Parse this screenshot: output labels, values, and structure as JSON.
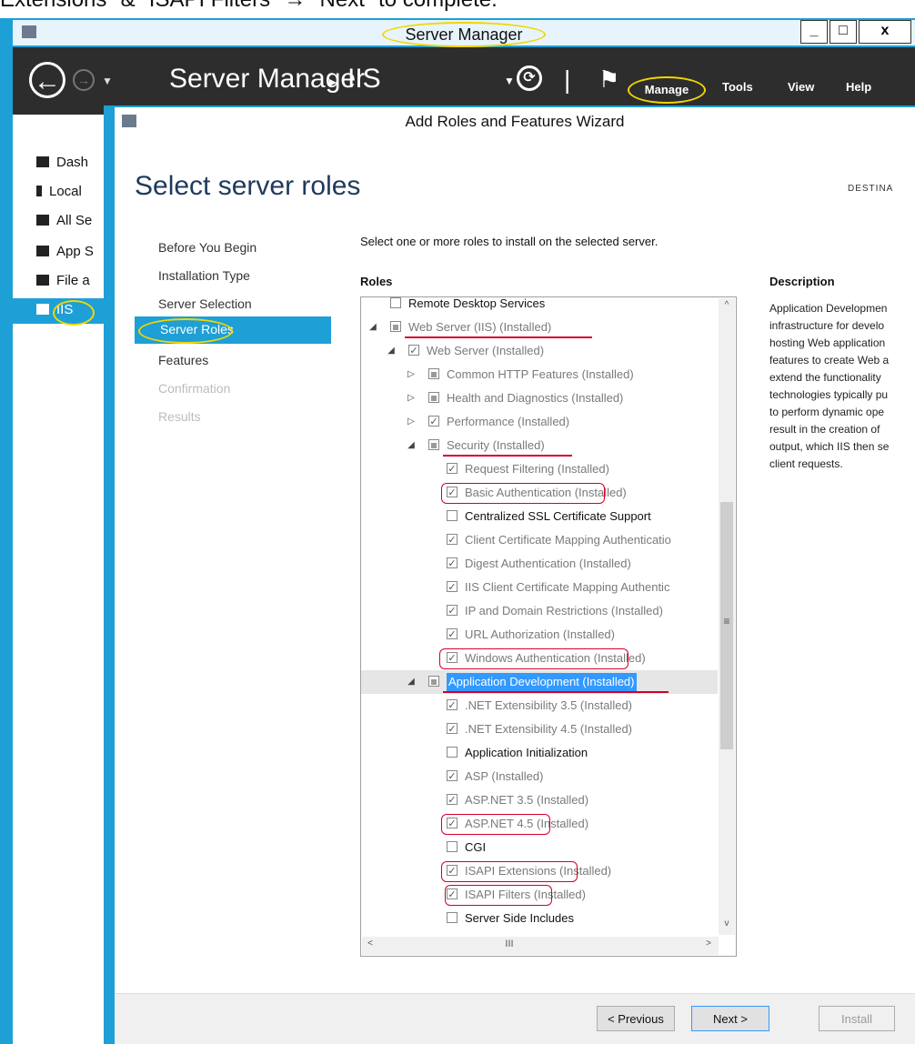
{
  "caption": "Extensions\" & \"ISAPI Filters\" → \"Next\" to complete.",
  "server_manager": {
    "window_title": "Server Manager",
    "window_buttons": [
      "_",
      "□",
      "x"
    ],
    "breadcrumb": [
      "Server Manager",
      "▸",
      "IIS"
    ],
    "menus": [
      "Manage",
      "Tools",
      "View",
      "Help"
    ],
    "sidebar": [
      "Dash",
      "Local",
      "All Se",
      "App S",
      "File a",
      "IIS"
    ]
  },
  "wizard": {
    "title": "Add Roles and Features Wizard",
    "page_title": "Select server roles",
    "destination_label": "DESTINA",
    "nav": [
      "Before You Begin",
      "Installation Type",
      "Server Selection",
      "Server Roles",
      "Features",
      "Confirmation",
      "Results"
    ],
    "instruction": "Select one or more roles to install on the selected server.",
    "roles_heading": "Roles",
    "description_heading": "Description",
    "description_text": "Application Developmen\ninfrastructure for develo\nhosting Web application\nfeatures to create Web a\nextend the functionality\ntechnologies typically pu\nto perform dynamic ope\nresult in the creation of\noutput, which IIS then se\nclient requests.",
    "roles": [
      {
        "label": "Remote Desktop Services",
        "level": 0,
        "expander": "",
        "check": "none",
        "muted": false
      },
      {
        "label": "Web Server (IIS) (Installed)",
        "level": 0,
        "expander": "◢",
        "check": "partial",
        "muted": true
      },
      {
        "label": "Web Server (Installed)",
        "level": 1,
        "expander": "◢",
        "check": "checked",
        "muted": true
      },
      {
        "label": "Common HTTP Features (Installed)",
        "level": 2,
        "expander": "▷",
        "check": "partial",
        "muted": true
      },
      {
        "label": "Health and Diagnostics (Installed)",
        "level": 2,
        "expander": "▷",
        "check": "partial",
        "muted": true
      },
      {
        "label": "Performance (Installed)",
        "level": 2,
        "expander": "▷",
        "check": "checked",
        "muted": true
      },
      {
        "label": "Security (Installed)",
        "level": 2,
        "expander": "◢",
        "check": "partial",
        "muted": true
      },
      {
        "label": "Request Filtering (Installed)",
        "level": 3,
        "expander": "",
        "check": "checked",
        "muted": true
      },
      {
        "label": "Basic Authentication (Installed)",
        "level": 3,
        "expander": "",
        "check": "checked",
        "muted": true
      },
      {
        "label": "Centralized SSL Certificate Support",
        "level": 3,
        "expander": "",
        "check": "none",
        "muted": false
      },
      {
        "label": "Client Certificate Mapping Authenticatio",
        "level": 3,
        "expander": "",
        "check": "checked",
        "muted": true
      },
      {
        "label": "Digest Authentication (Installed)",
        "level": 3,
        "expander": "",
        "check": "checked",
        "muted": true
      },
      {
        "label": "IIS Client Certificate Mapping Authentic",
        "level": 3,
        "expander": "",
        "check": "checked",
        "muted": true
      },
      {
        "label": "IP and Domain Restrictions (Installed)",
        "level": 3,
        "expander": "",
        "check": "checked",
        "muted": true
      },
      {
        "label": "URL Authorization (Installed)",
        "level": 3,
        "expander": "",
        "check": "checked",
        "muted": true
      },
      {
        "label": "Windows Authentication (Installed)",
        "level": 3,
        "expander": "",
        "check": "checked",
        "muted": true
      },
      {
        "label": "Application Development (Installed)",
        "level": 2,
        "expander": "◢",
        "check": "partial",
        "muted": true,
        "selected": true
      },
      {
        "label": ".NET Extensibility 3.5 (Installed)",
        "level": 3,
        "expander": "",
        "check": "checked",
        "muted": true
      },
      {
        "label": ".NET Extensibility 4.5 (Installed)",
        "level": 3,
        "expander": "",
        "check": "checked",
        "muted": true
      },
      {
        "label": "Application Initialization",
        "level": 3,
        "expander": "",
        "check": "none",
        "muted": false
      },
      {
        "label": "ASP (Installed)",
        "level": 3,
        "expander": "",
        "check": "checked",
        "muted": true
      },
      {
        "label": "ASP.NET 3.5 (Installed)",
        "level": 3,
        "expander": "",
        "check": "checked",
        "muted": true
      },
      {
        "label": "ASP.NET 4.5 (Installed)",
        "level": 3,
        "expander": "",
        "check": "checked",
        "muted": true
      },
      {
        "label": "CGI",
        "level": 3,
        "expander": "",
        "check": "none",
        "muted": false
      },
      {
        "label": "ISAPI Extensions (Installed)",
        "level": 3,
        "expander": "",
        "check": "checked",
        "muted": true
      },
      {
        "label": "ISAPI Filters (Installed)",
        "level": 3,
        "expander": "",
        "check": "checked",
        "muted": true
      },
      {
        "label": "Server Side Includes",
        "level": 3,
        "expander": "",
        "check": "none",
        "muted": false
      }
    ],
    "buttons": {
      "previous": "< Previous",
      "next": "Next >",
      "install": "Install"
    },
    "scroll": {
      "up": "^",
      "down": "v",
      "left": "<",
      "right": ">",
      "grip_v": "≡",
      "grip_h": "III"
    }
  },
  "annotation_colors": {
    "yellow": "#f2d600",
    "red": "#d4002a",
    "accent": "#1e9fd6"
  }
}
